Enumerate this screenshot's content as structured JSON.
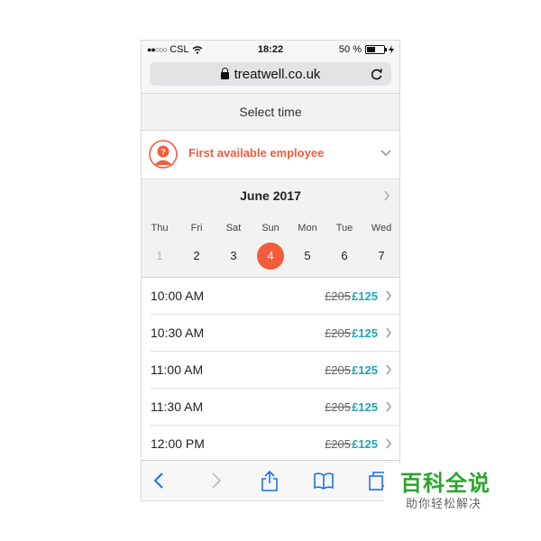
{
  "status": {
    "carrier": "CSL",
    "time": "18:22",
    "battery_text": "50 %",
    "battery_level": 0.5
  },
  "browser": {
    "url": "treatwell.co.uk"
  },
  "header": {
    "title": "Select time"
  },
  "employee": {
    "label": "First available employee",
    "accent": "#f25c3b"
  },
  "calendar": {
    "month": "June 2017",
    "days": [
      "Thu",
      "Fri",
      "Sat",
      "Sun",
      "Mon",
      "Tue",
      "Wed"
    ],
    "dates": [
      "1",
      "2",
      "3",
      "4",
      "5",
      "6",
      "7"
    ],
    "selected": "4"
  },
  "slots": [
    {
      "time": "10:00 AM",
      "old_price": "£205",
      "new_price": "£125"
    },
    {
      "time": "10:30 AM",
      "old_price": "£205",
      "new_price": "£125"
    },
    {
      "time": "11:00 AM",
      "old_price": "£205",
      "new_price": "£125"
    },
    {
      "time": "11:30 AM",
      "old_price": "£205",
      "new_price": "£125"
    },
    {
      "time": "12:00 PM",
      "old_price": "£205",
      "new_price": "£125"
    }
  ],
  "toolbar_icons": [
    "back-icon",
    "forward-icon",
    "share-icon",
    "bookmarks-icon",
    "tabs-icon"
  ],
  "colors": {
    "accent": "#f25c3b",
    "price": "#1fa6b3"
  },
  "watermark": {
    "title": "百科全说",
    "subtitle": "助你轻松解决"
  }
}
